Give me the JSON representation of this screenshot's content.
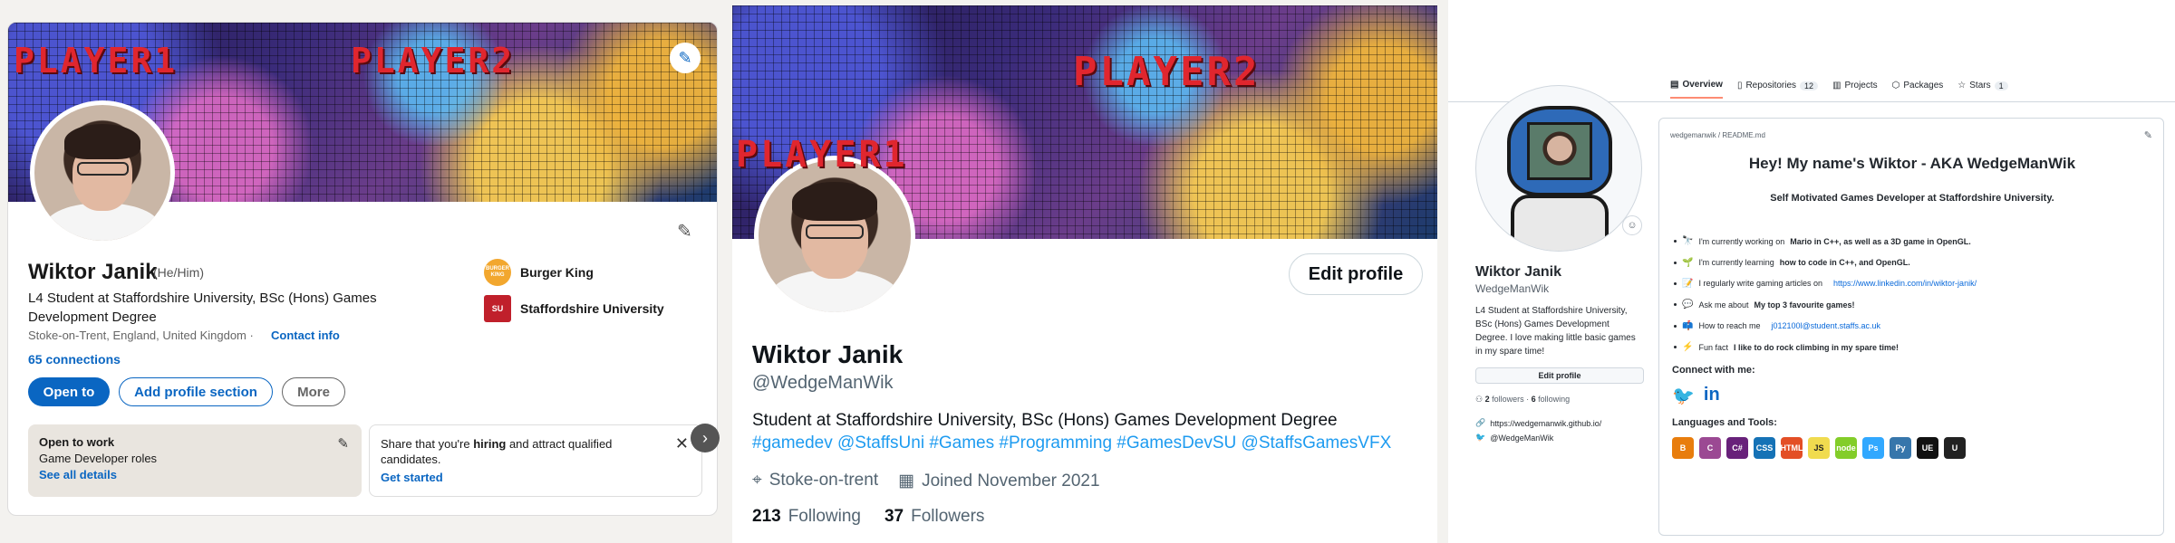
{
  "linkedin": {
    "banner_text": [
      "PLAYER1",
      "PLAYER2"
    ],
    "name": "Wiktor Janik",
    "pronouns": "(He/Him)",
    "headline": "L4 Student at Staffordshire University, BSc (Hons) Games Development Degree",
    "location": "Stoke-on-Trent, England, United Kingdom ·",
    "contact_info": "Contact info",
    "connections": "65 connections",
    "companies": [
      {
        "name": "Burger King",
        "logo": "BURGER KING"
      },
      {
        "name": "Staffordshire University",
        "logo": "SU"
      }
    ],
    "buttons": {
      "open_to": "Open to",
      "add_section": "Add profile section",
      "more": "More"
    },
    "open_to_work": {
      "title": "Open to work",
      "roles": "Game Developer roles",
      "link": "See all details"
    },
    "share_hiring": {
      "prefix": "Share that you're ",
      "bold": "hiring",
      "suffix": " and attract qualified candidates.",
      "link": "Get started"
    },
    "next_glyph": "›",
    "close_glyph": "✕"
  },
  "twitter": {
    "banner_text": [
      "PLAYER1",
      "PLAYER2"
    ],
    "edit_profile": "Edit profile",
    "name": "Wiktor Janik",
    "handle": "@WedgeManWik",
    "bio": "Student at Staffordshire University, BSc (Hons) Games Development Degree",
    "hashtags": "#gamedev @StaffsUni #Games #Programming #GamesDevSU @StaffsGamesVFX",
    "location": "Stoke-on-trent",
    "joined": "Joined November 2021",
    "following_count": "213",
    "following_label": "Following",
    "followers_count": "37",
    "followers_label": "Followers"
  },
  "github": {
    "tabs": [
      {
        "label": "Overview",
        "icon": "book-icon",
        "count": null
      },
      {
        "label": "Repositories",
        "icon": "repo-icon",
        "count": "12"
      },
      {
        "label": "Projects",
        "icon": "project-icon",
        "count": null
      },
      {
        "label": "Packages",
        "icon": "package-icon",
        "count": null
      },
      {
        "label": "Stars",
        "icon": "star-icon",
        "count": "1"
      }
    ],
    "name": "Wiktor Janik",
    "login": "WedgeManWik",
    "bio": "L4 Student at Staffordshire University, BSc (Hons) Games Development Degree. I love making little basic games in my spare time!",
    "edit_profile": "Edit profile",
    "followers": "2",
    "followers_label": "followers ·",
    "following": "6",
    "following_label": "following",
    "website": "https://wedgemanwik.github.io/",
    "twitter": "@WedgeManWik",
    "readme_path": "wedgemanwik / README.md",
    "readme_title": "Hey! My name's Wiktor - AKA WedgeManWik",
    "readme_subtitle": "Self Motivated Games Developer at Staffordshire University.",
    "readme_items": [
      {
        "emoji": "🔭",
        "pre": "I'm currently working on ",
        "bold": "Mario in C++, as well as a 3D game in OpenGL.",
        "link": ""
      },
      {
        "emoji": "🌱",
        "pre": "I'm currently learning ",
        "bold": "how to code in C++, and OpenGL.",
        "link": ""
      },
      {
        "emoji": "📝",
        "pre": "I regularly write gaming articles on ",
        "bold": "",
        "link": "https://www.linkedin.com/in/wiktor-janik/"
      },
      {
        "emoji": "💬",
        "pre": "Ask me about ",
        "bold": "My top 3 favourite games!",
        "link": ""
      },
      {
        "emoji": "📫",
        "pre": "How to reach me ",
        "bold": "",
        "link": "j012100l@student.staffs.ac.uk"
      },
      {
        "emoji": "⚡",
        "pre": "Fun fact ",
        "bold": "I like to do rock climbing in my spare time!",
        "link": ""
      }
    ],
    "connect_heading": "Connect with me:",
    "tools_heading": "Languages and Tools:",
    "tools": [
      {
        "label": "B",
        "color": "#e87d0d"
      },
      {
        "label": "C",
        "color": "#9b4993"
      },
      {
        "label": "C#",
        "color": "#68217a"
      },
      {
        "label": "CSS",
        "color": "#1572b6"
      },
      {
        "label": "HTML",
        "color": "#e34f26"
      },
      {
        "label": "JS",
        "color": "#f0db4f"
      },
      {
        "label": "node",
        "color": "#83cd29"
      },
      {
        "label": "Ps",
        "color": "#31a8ff"
      },
      {
        "label": "Py",
        "color": "#3776ab"
      },
      {
        "label": "UE",
        "color": "#111111"
      },
      {
        "label": "U",
        "color": "#222222"
      }
    ]
  }
}
